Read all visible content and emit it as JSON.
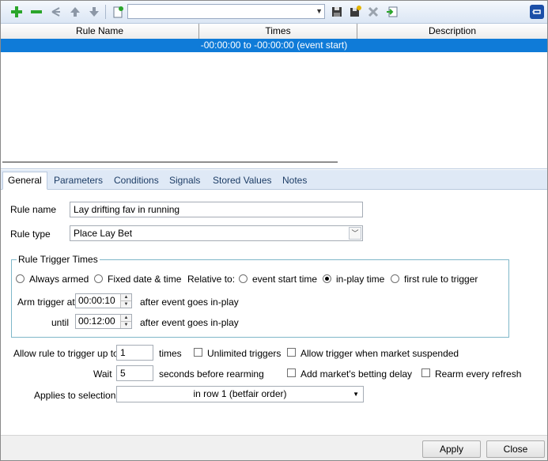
{
  "toolbar": {
    "icons": [
      "add-icon",
      "remove-icon",
      "branch-icon",
      "move-up-icon",
      "move-down-icon",
      "new-document-icon",
      "save-icon",
      "save-as-icon",
      "delete-icon",
      "import-icon",
      "pin-icon"
    ],
    "combo_value": ""
  },
  "grid": {
    "columns": [
      "Rule Name",
      "Times",
      "Description"
    ],
    "rows": [
      {
        "rule_name": "",
        "times": "-00:00:00 to -00:00:00 (event start)",
        "description": ""
      }
    ]
  },
  "tabs": [
    "General",
    "Parameters",
    "Conditions",
    "Signals",
    "Stored Values",
    "Notes"
  ],
  "active_tab": "General",
  "form": {
    "rule_name_label": "Rule name",
    "rule_name_value": "Lay drifting fav in running",
    "rule_type_label": "Rule type",
    "rule_type_value": "Place Lay Bet",
    "trigger_group_title": "Rule Trigger Times",
    "opt_always_armed": "Always armed",
    "opt_fixed_date": "Fixed date & time",
    "relative_to_label": "Relative to:",
    "opt_event_start": "event start time",
    "opt_inplay_time": "in-play time",
    "opt_first_rule": "first rule to trigger",
    "arm_trigger_label": "Arm trigger at",
    "arm_trigger_value": "00:00:10",
    "after_inplay_1": "after event goes in-play",
    "until_label": "until",
    "until_value": "00:12:00",
    "after_inplay_2": "after event goes in-play",
    "allow_trigger_label": "Allow rule to trigger up to",
    "allow_trigger_value": "1",
    "times_label": "times",
    "unlimited_triggers": "Unlimited triggers",
    "allow_suspended": "Allow trigger when market suspended",
    "wait_label": "Wait",
    "wait_value": "5",
    "seconds_label": "seconds before rearming",
    "add_delay": "Add market's betting delay",
    "rearm_refresh": "Rearm every refresh",
    "applies_label": "Applies to selection",
    "applies_value": "in row 1 (betfair order)"
  },
  "buttons": {
    "apply": "Apply",
    "close": "Close"
  },
  "colors": {
    "selected_row": "#0f7bd8",
    "tab_strip": "#dfe9f6",
    "group_border": "#7fb7c9"
  }
}
